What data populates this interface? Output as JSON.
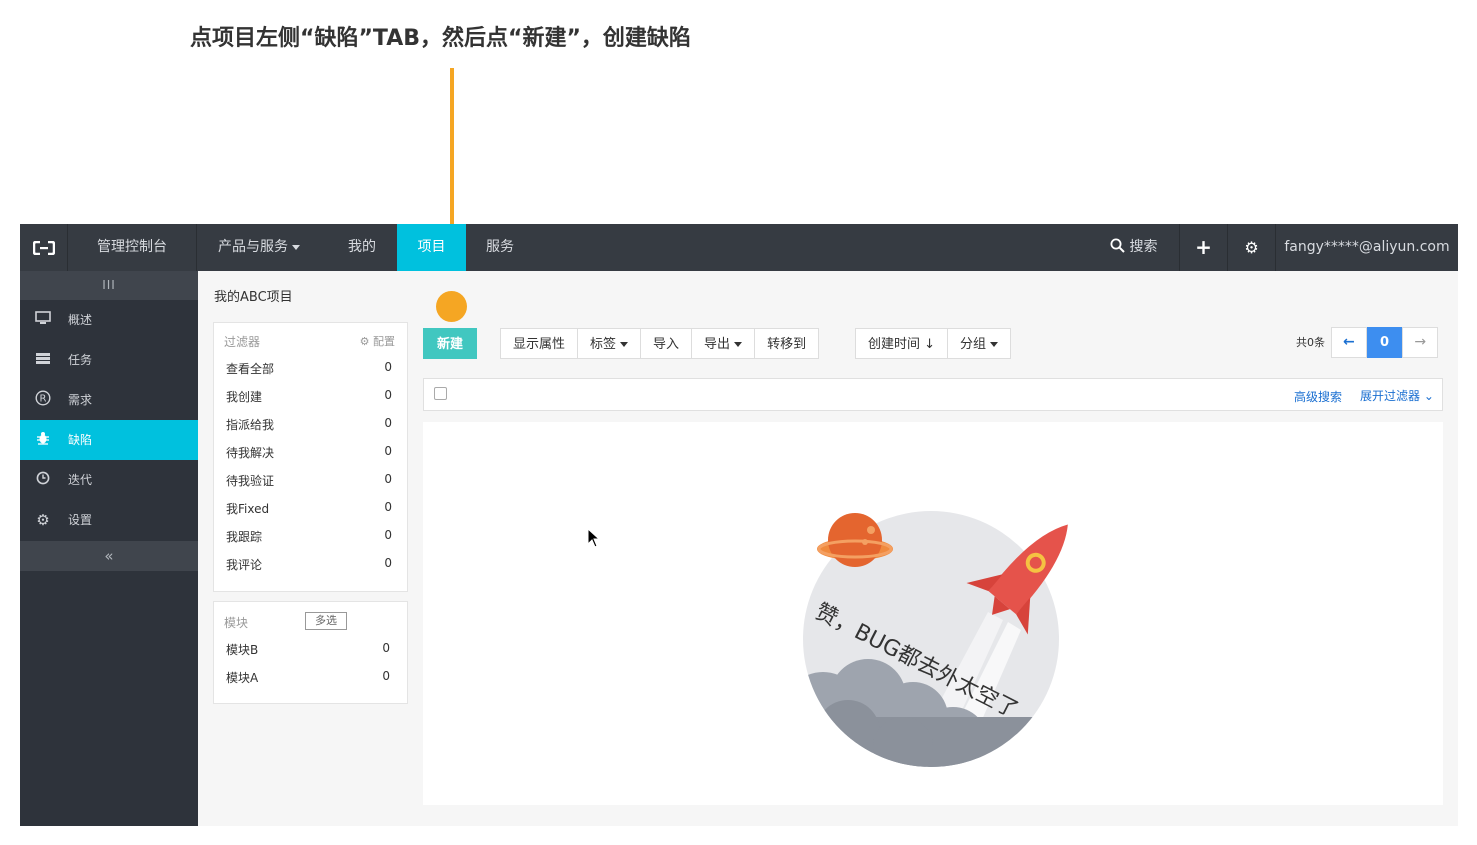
{
  "annotation": {
    "instruction": "点项目左侧“缺陷”TAB，然后点“新建”，创建缺陷",
    "color": "#f5a623"
  },
  "topbar": {
    "logo_icon": "aliyun-logo-icon",
    "console": "管理控制台",
    "products": "产品与服务",
    "mine": "我的",
    "project": "项目",
    "service": "服务",
    "search": "搜索",
    "plus_icon": "+",
    "gear_icon": "⚙",
    "user": "fangy*****@aliyun.com",
    "bg_color": "#363b42",
    "active_color": "#00c1de"
  },
  "sidebar": {
    "toggle": "III",
    "items": [
      {
        "icon": "monitor-icon",
        "label": "概述"
      },
      {
        "icon": "list-icon",
        "label": "任务"
      },
      {
        "icon": "registered-icon",
        "label": "需求"
      },
      {
        "icon": "bug-icon",
        "label": "缺陷"
      },
      {
        "icon": "clock-icon",
        "label": "迭代"
      },
      {
        "icon": "gear-icon",
        "label": "设置"
      }
    ],
    "active_index": 3,
    "collapse": "«"
  },
  "main": {
    "project_title": "我的ABC项目",
    "filter_panel": {
      "title": "过滤器",
      "config": "⚙ 配置",
      "rows": [
        {
          "label": "查看全部",
          "count": "0"
        },
        {
          "label": "我创建",
          "count": "0"
        },
        {
          "label": "指派给我",
          "count": "0"
        },
        {
          "label": "待我解决",
          "count": "0"
        },
        {
          "label": "待我验证",
          "count": "0"
        },
        {
          "label": "我Fixed",
          "count": "0"
        },
        {
          "label": "我跟踪",
          "count": "0"
        },
        {
          "label": "我评论",
          "count": "0"
        }
      ]
    },
    "module_panel": {
      "title": "模块",
      "multi_select": "多选",
      "rows": [
        {
          "label": "模块B",
          "count": "0"
        },
        {
          "label": "模块A",
          "count": "0"
        }
      ]
    },
    "toolbar": {
      "new": "新建",
      "show_props": "显示属性",
      "tags": "标签",
      "import": "导入",
      "export": "导出",
      "move_to": "转移到",
      "created_time": "创建时间 ↓",
      "group": "分组"
    },
    "pagination": {
      "total": "共0条",
      "prev": "←",
      "current": "0",
      "next": "→"
    },
    "search_bar": {
      "advanced": "高级搜索",
      "expand_filter": "展开过滤器 ⌄"
    },
    "empty_state": {
      "message": "赞，BUG都去外太空了"
    }
  }
}
